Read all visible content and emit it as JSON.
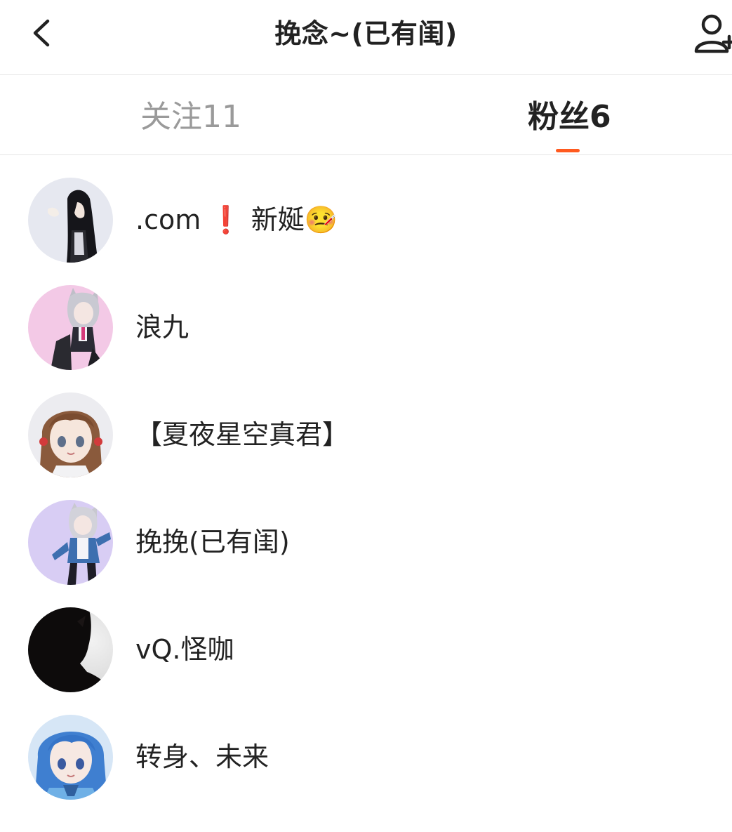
{
  "header": {
    "title": "挽念~(已有闺)",
    "back_icon": "chevron-left-icon",
    "add_user_icon": "add-user-icon"
  },
  "tabs": [
    {
      "label": "关注11",
      "active": false
    },
    {
      "label": "粉丝6",
      "active": true
    }
  ],
  "colors": {
    "accent": "#ff5a1f",
    "text": "#222222",
    "inactive_tab": "#9a9a9a",
    "divider": "#e6e6e6"
  },
  "fans": [
    {
      "name": ".com ❗ 新娫🤒",
      "avatar": "avatar-girl-dark-hair"
    },
    {
      "name": "浪九",
      "avatar": "avatar-catgirl-pink"
    },
    {
      "name": "【夏夜星空真君】",
      "avatar": "avatar-brown-hair-girl"
    },
    {
      "name": "挽挽(已有闺)",
      "avatar": "avatar-catgirl-blue"
    },
    {
      "name": "vQ.怪咖",
      "avatar": "avatar-silhouette-dark"
    },
    {
      "name": "转身、未来",
      "avatar": "avatar-blue-hair-girl"
    }
  ]
}
